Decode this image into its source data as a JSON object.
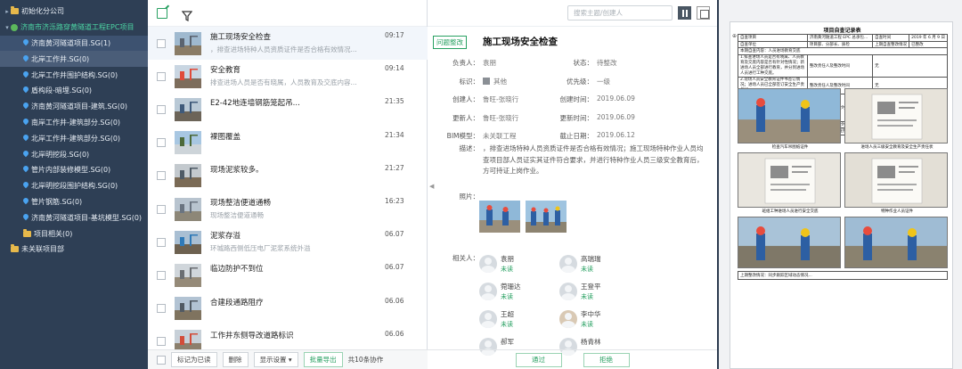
{
  "sidebar": {
    "items": [
      {
        "label": "初始化分公司",
        "kind": "folder",
        "indent": 0,
        "caret": "▸"
      },
      {
        "label": "济南市济泺路穿黄隧道工程EPC项目",
        "kind": "proj",
        "indent": 0,
        "caret": "▾"
      },
      {
        "label": "济南黄河隧道项目.SG(1)",
        "kind": "pin",
        "indent": 1,
        "caret": "",
        "state": "active"
      },
      {
        "label": "北岸工作井.SG(0)",
        "kind": "pin",
        "indent": 1,
        "caret": "",
        "state": "hover"
      },
      {
        "label": "北岸工作井围护结构.SG(0)",
        "kind": "pin",
        "indent": 1,
        "caret": ""
      },
      {
        "label": "盾构段-暗埋.SG(0)",
        "kind": "pin",
        "indent": 1,
        "caret": ""
      },
      {
        "label": "济南黄河隧道项目-建筑.SG(0)",
        "kind": "pin",
        "indent": 1,
        "caret": ""
      },
      {
        "label": "南岸工作井-建筑部分.SG(0)",
        "kind": "pin",
        "indent": 1,
        "caret": ""
      },
      {
        "label": "北岸工作井-建筑部分.SG(0)",
        "kind": "pin",
        "indent": 1,
        "caret": ""
      },
      {
        "label": "北岸明挖段.SG(0)",
        "kind": "pin",
        "indent": 1,
        "caret": ""
      },
      {
        "label": "管片内部装修模型.SG(0)",
        "kind": "pin",
        "indent": 1,
        "caret": ""
      },
      {
        "label": "北岸明挖段围护结构.SG(0)",
        "kind": "pin",
        "indent": 1,
        "caret": ""
      },
      {
        "label": "管片钢筋.SG(0)",
        "kind": "pin",
        "indent": 1,
        "caret": ""
      },
      {
        "label": "济南黄河隧道项目-基坑模型.SG(0)",
        "kind": "pin",
        "indent": 1,
        "caret": ""
      },
      {
        "label": "项目相关(0)",
        "kind": "folder",
        "indent": 1,
        "caret": ""
      },
      {
        "label": "未关联项目部",
        "kind": "folder",
        "indent": 0,
        "caret": ""
      }
    ]
  },
  "list": {
    "items": [
      {
        "title": "施工现场安全检查",
        "sub": "，排查进场特种人员资质证件是否合格有效情况...",
        "time": "09:17",
        "selected": true,
        "thumb": "crane"
      },
      {
        "title": "安全教育",
        "sub": "排查进场人员是否有晓属，人员教育及交底内容...",
        "time": "09:14",
        "selected": false,
        "thumb": "people"
      },
      {
        "title": "E2-42地连墙钢筋笼起吊...",
        "sub": "",
        "time": "21:35",
        "selected": false,
        "thumb": "site"
      },
      {
        "title": "裸图覆盖",
        "sub": "",
        "time": "21:34",
        "selected": false,
        "thumb": "sky"
      },
      {
        "title": "现场泥浆较多。",
        "sub": "",
        "time": "21:27",
        "selected": false,
        "thumb": "mud"
      },
      {
        "title": "现场整洁便道通畅",
        "sub": "现场整洁便道通畅",
        "time": "16:23",
        "selected": false,
        "thumb": "road"
      },
      {
        "title": "泥浆存溢",
        "sub": "环城路西侧低压电厂泥浆系统外溢",
        "time": "06.07",
        "selected": false,
        "thumb": "mud2"
      },
      {
        "title": "临边防护不到位",
        "sub": "",
        "time": "06.07",
        "selected": false,
        "thumb": "site2"
      },
      {
        "title": "合建段通路阻疗",
        "sub": "",
        "time": "06.06",
        "selected": false,
        "thumb": "site3"
      },
      {
        "title": "工作井东侧导改道路标识",
        "sub": "",
        "time": "06.06",
        "selected": false,
        "thumb": "site4"
      }
    ],
    "footer": {
      "mark_read": "标记为已读",
      "delete": "删除",
      "display": "显示设置 ▾",
      "export": "批量导出",
      "count": "共10条协作"
    }
  },
  "detail": {
    "search_placeholder": "搜索主题/创建人",
    "tag": "问题整改",
    "title": "施工现场安全检查",
    "fields": [
      {
        "label": "负责人：",
        "value": "袁朋",
        "col": 0,
        "row": 0
      },
      {
        "label": "状态：",
        "value": "待整改",
        "col": 1,
        "row": 0
      },
      {
        "label": "标识：",
        "value": "其他",
        "col": 0,
        "row": 1,
        "swatch": true
      },
      {
        "label": "优先级：",
        "value": "一级",
        "col": 1,
        "row": 1
      },
      {
        "label": "创建人：",
        "value": "鲁旺-张晓行",
        "col": 0,
        "row": 2
      },
      {
        "label": "创建时间：",
        "value": "2019.06.09",
        "col": 1,
        "row": 2
      },
      {
        "label": "更新人：",
        "value": "鲁旺-张晓行",
        "col": 0,
        "row": 3
      },
      {
        "label": "更新时间：",
        "value": "2019.06.09",
        "col": 1,
        "row": 3
      },
      {
        "label": "BIM模型：",
        "value": "未关联工程",
        "col": 0,
        "row": 4
      },
      {
        "label": "截止日期：",
        "value": "2019.06.12",
        "col": 1,
        "row": 4
      }
    ],
    "desc_label": "描述：",
    "desc": "，排查进场特种人员资质证件是否合格有效情况；施工现场特种作业人员均查项目部人员证实其证件符合要求，并进行特种作业人员三级安全教育后，方可持证上岗作业。",
    "photos_label": "照片：",
    "related_label": "相关人：",
    "people": [
      {
        "name": "袁朋",
        "status": "未读",
        "photo": false
      },
      {
        "name": "高瑞瑞",
        "status": "未读",
        "photo": false
      },
      {
        "name": "菀珊达",
        "status": "未读",
        "photo": false
      },
      {
        "name": "王登平",
        "status": "未读",
        "photo": false
      },
      {
        "name": "王超",
        "status": "未读",
        "photo": false
      },
      {
        "name": "李中华",
        "status": "未读",
        "photo": true
      },
      {
        "name": "郝军",
        "status": "",
        "photo": false
      },
      {
        "name": "杨青林",
        "status": "",
        "photo": false
      }
    ],
    "approve": "通过",
    "reject": "拒绝"
  },
  "doc": {
    "title": "项目自查记录表",
    "rows": [
      [
        "自查项目",
        "济南黄河隧道工程 EPC 总承包...",
        "自查时间",
        "2019 年 6 月 9 日"
      ],
      [
        "自查单位",
        "项目部、分部长、质检",
        "上期自查整改情况",
        "已整改"
      ],
      [
        "本期自查内容：人员进场教育交底",
        "",
        "",
        ""
      ],
      [
        "1.排查进场人员是否有晓属、人员教育及交底内容是否有针对性情况；新进场人员全部进行教育，并分到进场人员进行工种交底。",
        "整改责任人及整改时间",
        "无",
        ""
      ],
      [
        "2.现场人员安全教育证件书签订情况；进场人员已全部签订安全生产责任状。",
        "整改责任人及整改时间",
        "无",
        ""
      ],
      [
        "3.排查进场特种人员资质证件是否合格有效情况；施工现场特种作业人员均查项目部人员证实其证件符合要求，并进行特种作业人员三级安全教育后，方可持证上岗作业。",
        "整改责任人及整改时间",
        "无",
        ""
      ],
      [
        "4.其他：日常巡检表面悬挂",
        "整改责任人及整改时间",
        "杨龙，立即整改",
        ""
      ]
    ],
    "photo_header": "检查照片",
    "captions": [
      "检查汽车吊图纸证件",
      "进场人员三级安全教育及安全生产责任状",
      "班组工种进场人员进行安全交底",
      "特种作业人员证件"
    ],
    "bottom_text": "上期整改情况：同步跟踪区域动态情况..."
  }
}
